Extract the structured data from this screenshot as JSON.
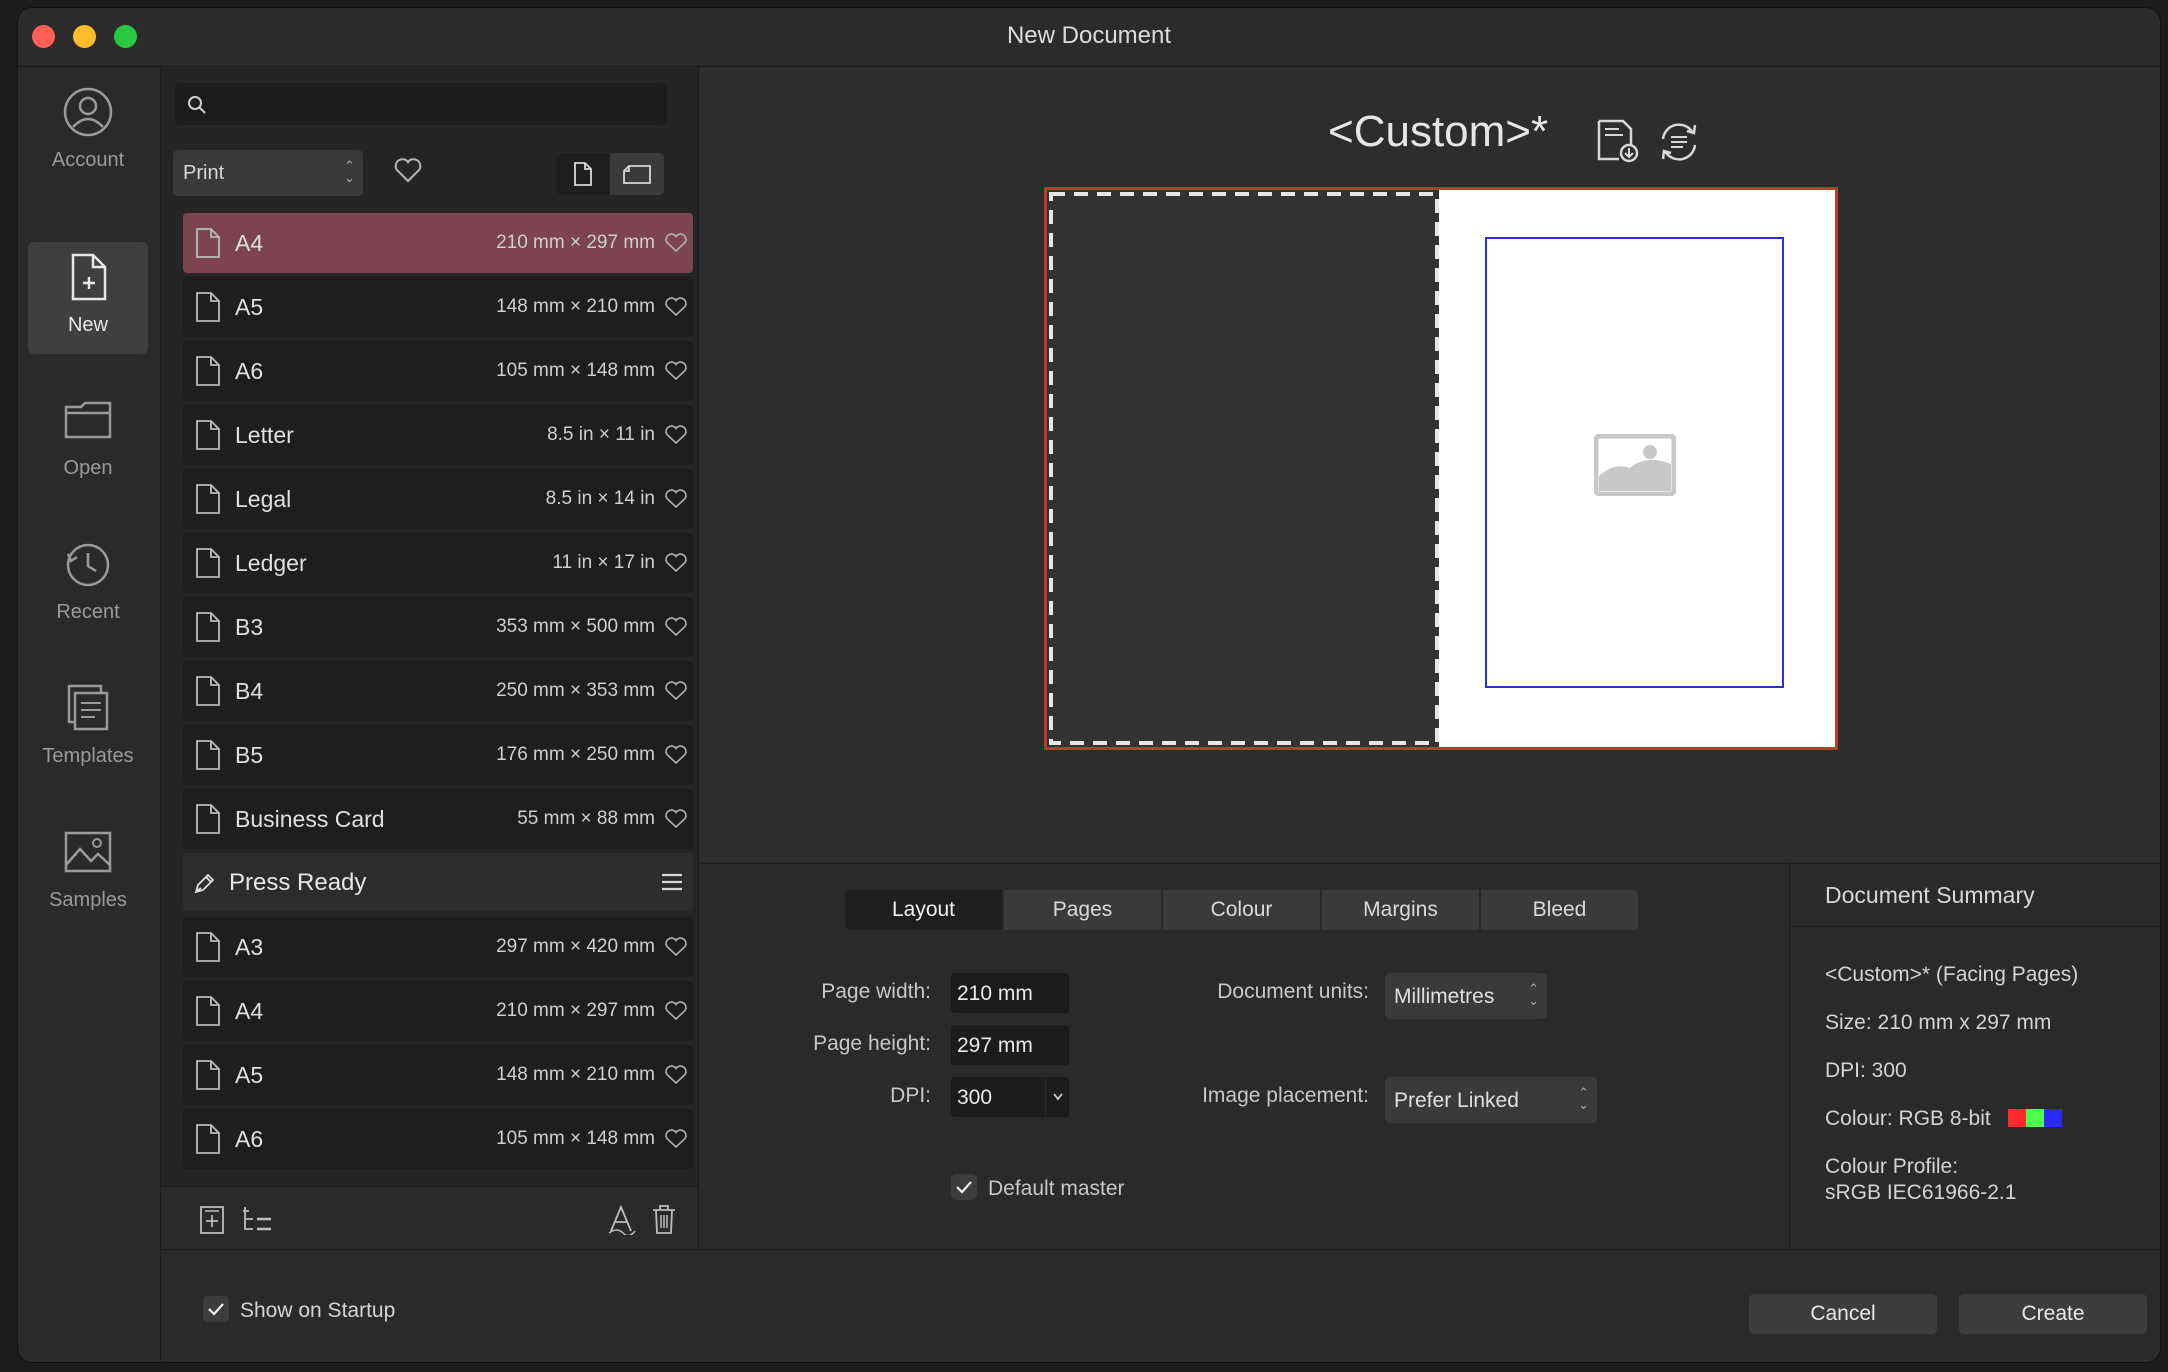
{
  "window": {
    "title": "New Document"
  },
  "nav": {
    "items": [
      {
        "label": "Account"
      },
      {
        "label": "New"
      },
      {
        "label": "Open"
      },
      {
        "label": "Recent"
      },
      {
        "label": "Templates"
      },
      {
        "label": "Samples"
      }
    ]
  },
  "presets": {
    "category": "Print",
    "items": [
      {
        "name": "A4",
        "dims": "210 mm × 297 mm"
      },
      {
        "name": "A5",
        "dims": "148 mm × 210 mm"
      },
      {
        "name": "A6",
        "dims": "105 mm × 148 mm"
      },
      {
        "name": "Letter",
        "dims": "8.5 in × 11 in"
      },
      {
        "name": "Legal",
        "dims": "8.5 in × 14 in"
      },
      {
        "name": "Ledger",
        "dims": "11 in × 17 in"
      },
      {
        "name": "B3",
        "dims": "353 mm × 500 mm"
      },
      {
        "name": "B4",
        "dims": "250 mm × 353 mm"
      },
      {
        "name": "B5",
        "dims": "176 mm × 250 mm"
      },
      {
        "name": "Business Card",
        "dims": "55 mm × 88 mm"
      }
    ],
    "group": {
      "name": "Press Ready",
      "items": [
        {
          "name": "A3",
          "dims": "297 mm × 420 mm"
        },
        {
          "name": "A4",
          "dims": "210 mm × 297 mm"
        },
        {
          "name": "A5",
          "dims": "148 mm × 210 mm"
        },
        {
          "name": "A6",
          "dims": "105 mm × 148 mm"
        }
      ]
    }
  },
  "preview": {
    "preset_name": "<Custom>*"
  },
  "tabs": [
    "Layout",
    "Pages",
    "Colour",
    "Margins",
    "Bleed"
  ],
  "layout": {
    "page_width_label": "Page width:",
    "page_width": "210 mm",
    "page_height_label": "Page height:",
    "page_height": "297 mm",
    "dpi_label": "DPI:",
    "dpi": "300",
    "units_label": "Document units:",
    "units": "Millimetres",
    "placement_label": "Image placement:",
    "placement": "Prefer Linked",
    "default_master_label": "Default master"
  },
  "summary": {
    "title": "Document Summary",
    "name_line": "<Custom>* (Facing Pages)",
    "size_line": "Size: 210 mm x 297 mm",
    "dpi_line": "DPI:  300",
    "colour_line": "Colour: RGB 8-bit",
    "profile_label": "Colour Profile:",
    "profile_value": "sRGB IEC61966-2.1",
    "swatches": [
      "#ff2a2a",
      "#4cff4c",
      "#2a2aff"
    ]
  },
  "footer": {
    "show_on_startup": "Show on Startup",
    "cancel": "Cancel",
    "create": "Create"
  }
}
